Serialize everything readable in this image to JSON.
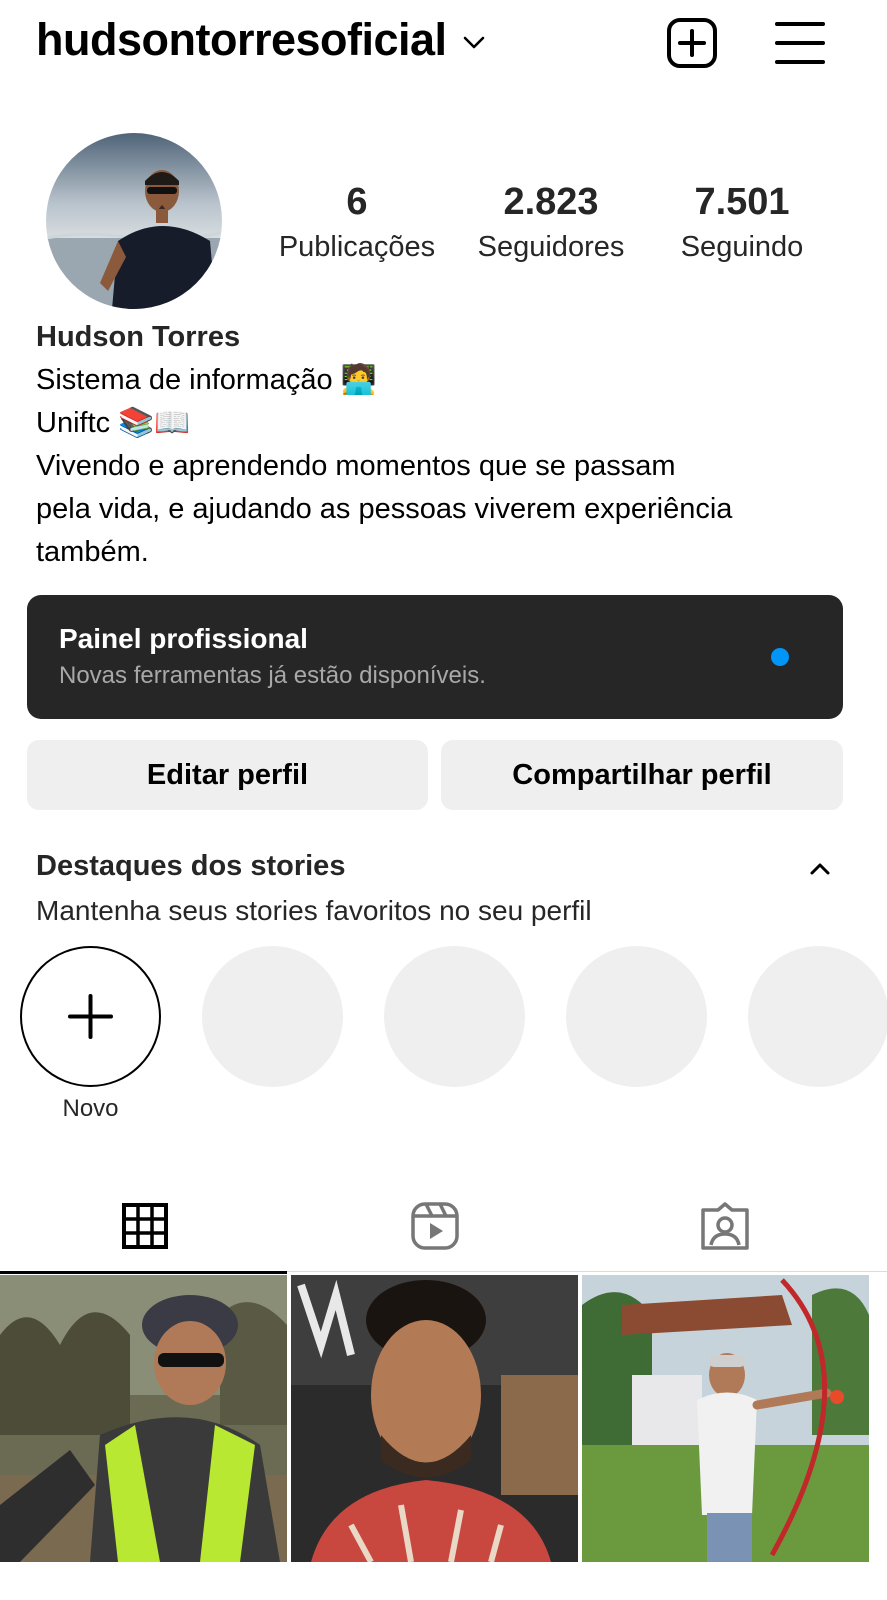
{
  "header": {
    "username": "hudsontorresoficial",
    "icons": [
      "chevron-down-icon",
      "new-post-icon",
      "menu-icon"
    ]
  },
  "stats": [
    {
      "value": "6",
      "label": "Publicações"
    },
    {
      "value": "2.823",
      "label": "Seguidores"
    },
    {
      "value": "7.501",
      "label": "Seguindo"
    }
  ],
  "bio": {
    "name": "Hudson Torres",
    "lines": [
      "Sistema de informação 🧑‍💻",
      "Uniftc 📚📖",
      "Vivendo e aprendendo momentos que se passam",
      "pela vida, e ajudando as pessoas viverem experiência",
      "também."
    ]
  },
  "professional_panel": {
    "title": "Painel profissional",
    "subtitle": "Novas ferramentas já estão disponíveis."
  },
  "buttons": {
    "edit_profile": "Editar perfil",
    "share_profile": "Compartilhar perfil"
  },
  "highlights": {
    "title": "Destaques dos stories",
    "subtitle": "Mantenha seus stories favoritos no seu perfil",
    "new_label": "Novo"
  },
  "tabs": [
    "grid-icon",
    "reels-icon",
    "tagged-icon"
  ],
  "colors": {
    "panel_bg": "#262626",
    "dot": "#0095f6",
    "button_bg": "#efefef"
  }
}
